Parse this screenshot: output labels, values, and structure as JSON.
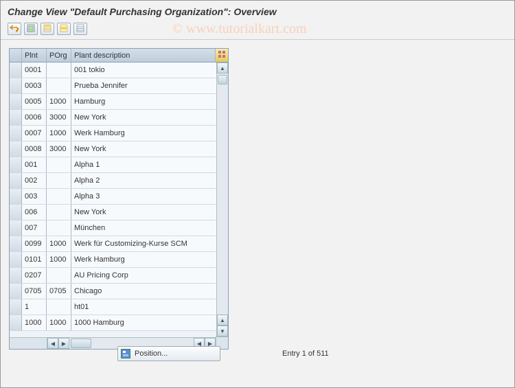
{
  "title": "Change View \"Default Purchasing Organization\": Overview",
  "watermark": "© www.tutorialkart.com",
  "toolbar": {
    "btn1_icon": "undo-redo-icon",
    "btn2_icon": "other-entries-icon",
    "btn3_icon": "select-all-icon",
    "btn4_icon": "select-block-icon",
    "btn5_icon": "deselect-all-icon"
  },
  "table": {
    "columns": {
      "plnt": "Plnt",
      "porg": "POrg",
      "desc": "Plant description"
    },
    "rows": [
      {
        "plnt": "0001",
        "porg": "",
        "desc": "001 tokio"
      },
      {
        "plnt": "0003",
        "porg": "",
        "desc": "Prueba Jennifer"
      },
      {
        "plnt": "0005",
        "porg": "1000",
        "desc": "Hamburg"
      },
      {
        "plnt": "0006",
        "porg": "3000",
        "desc": "New York"
      },
      {
        "plnt": "0007",
        "porg": "1000",
        "desc": "Werk Hamburg"
      },
      {
        "plnt": "0008",
        "porg": "3000",
        "desc": "New York"
      },
      {
        "plnt": "001",
        "porg": "",
        "desc": "Alpha 1"
      },
      {
        "plnt": "002",
        "porg": "",
        "desc": "Alpha 2"
      },
      {
        "plnt": "003",
        "porg": "",
        "desc": "Alpha 3"
      },
      {
        "plnt": "006",
        "porg": "",
        "desc": "New York"
      },
      {
        "plnt": "007",
        "porg": "",
        "desc": "München"
      },
      {
        "plnt": "0099",
        "porg": "1000",
        "desc": "Werk für Customizing-Kurse SCM"
      },
      {
        "plnt": "0101",
        "porg": "1000",
        "desc": "Werk Hamburg"
      },
      {
        "plnt": "0207",
        "porg": "",
        "desc": "AU Pricing Corp"
      },
      {
        "plnt": "0705",
        "porg": "0705",
        "desc": "Chicago"
      },
      {
        "plnt": "1",
        "porg": "",
        "desc": "ht01"
      },
      {
        "plnt": "1000",
        "porg": "1000",
        "desc": "1000 Hamburg"
      }
    ]
  },
  "footer": {
    "position_label": "Position...",
    "entry_label": "Entry 1 of 511"
  }
}
